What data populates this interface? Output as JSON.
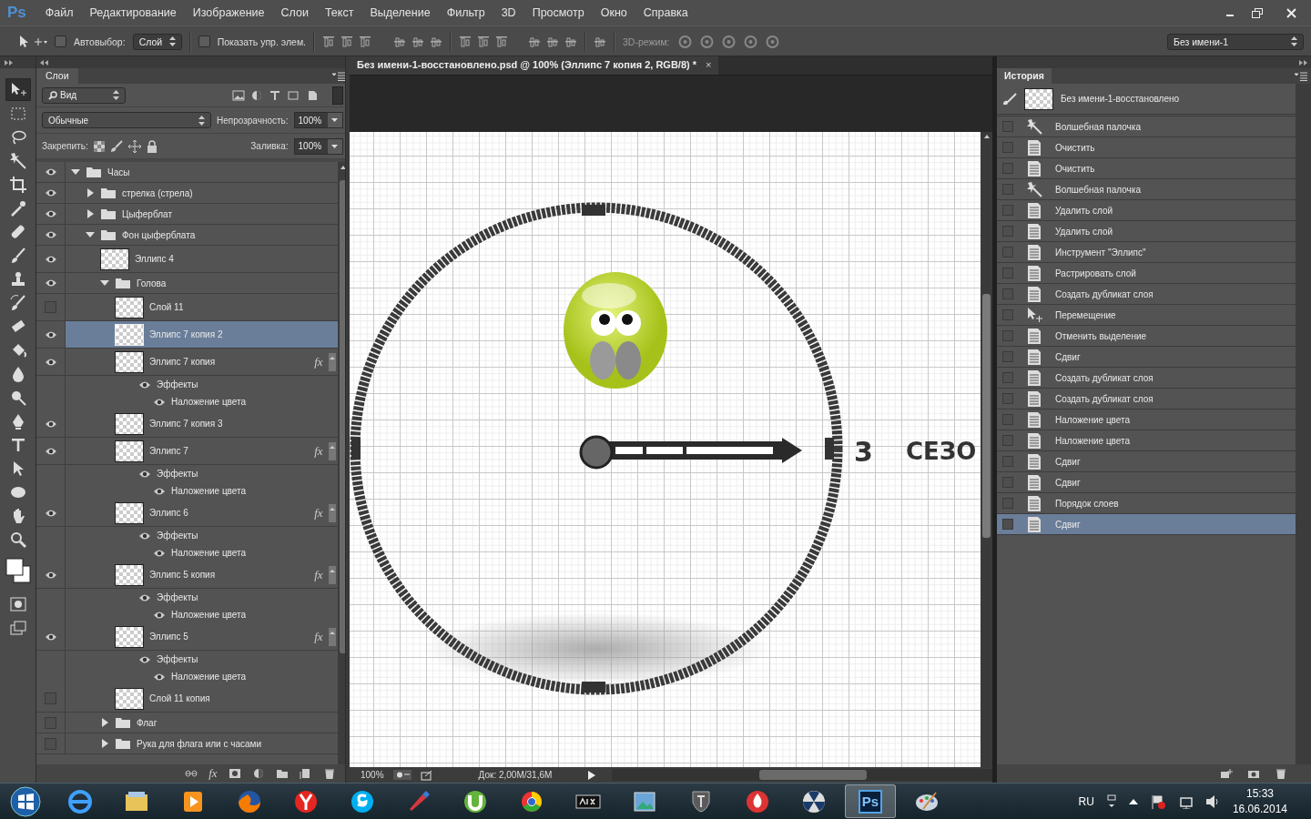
{
  "app": {
    "logo": "Ps",
    "menu": [
      "Файл",
      "Редактирование",
      "Изображение",
      "Слои",
      "Текст",
      "Выделение",
      "Фильтр",
      "3D",
      "Просмотр",
      "Окно",
      "Справка"
    ]
  },
  "options_bar": {
    "auto_select": {
      "label": "Автовыбор:",
      "checked": false
    },
    "target": "Слой",
    "show_controls": {
      "label": "Показать упр. элем.",
      "checked": false
    },
    "mode_3d_label": "3D-режим:",
    "workspace": "Без имени-1"
  },
  "tools": [
    {
      "kind": "move",
      "selected": true
    },
    {
      "kind": "marquee",
      "selected": false
    },
    {
      "kind": "lasso",
      "selected": false
    },
    {
      "kind": "wand",
      "selected": false
    },
    {
      "kind": "crop",
      "selected": false
    },
    {
      "kind": "eyedropper",
      "selected": false
    },
    {
      "kind": "healing",
      "selected": false
    },
    {
      "kind": "brush",
      "selected": false
    },
    {
      "kind": "stamp",
      "selected": false
    },
    {
      "kind": "history-brush",
      "selected": false
    },
    {
      "kind": "eraser",
      "selected": false
    },
    {
      "kind": "bucket",
      "selected": false
    },
    {
      "kind": "blur",
      "selected": false
    },
    {
      "kind": "dodge",
      "selected": false
    },
    {
      "kind": "pen",
      "selected": false
    },
    {
      "kind": "type",
      "selected": false
    },
    {
      "kind": "path-select",
      "selected": false
    },
    {
      "kind": "ellipse",
      "selected": false
    },
    {
      "kind": "hand",
      "selected": false
    },
    {
      "kind": "zoom",
      "selected": false
    }
  ],
  "layers_panel": {
    "tab": "Слои",
    "filter": "Вид",
    "blend_mode": "Обычные",
    "opacity_label": "Непрозрачность:",
    "opacity": "100%",
    "lock_label": "Закрепить:",
    "fill_label": "Заливка:",
    "fill": "100%",
    "footer_fx": "fx",
    "layers": [
      {
        "name": "Часы",
        "kind": "folder",
        "visible": true,
        "expanded": true,
        "selected": false,
        "children": [
          {
            "name": "стрелка (стрела)",
            "kind": "folder",
            "visible": true,
            "expanded": false,
            "selected": false
          },
          {
            "name": "Цыферблат",
            "kind": "folder",
            "visible": true,
            "expanded": false,
            "selected": false
          },
          {
            "name": "Фон цыферблата",
            "kind": "folder",
            "visible": true,
            "expanded": true,
            "selected": false,
            "children": [
              {
                "name": "Эллипс 4",
                "kind": "layer",
                "visible": true,
                "selected": false
              },
              {
                "name": "Голова",
                "kind": "folder",
                "visible": true,
                "expanded": true,
                "selected": false,
                "children": [
                  {
                    "name": "Слой 11",
                    "kind": "layer",
                    "visible": false,
                    "selected": false
                  },
                  {
                    "name": "Эллипс 7 копия 2",
                    "kind": "layer",
                    "visible": true,
                    "selected": true
                  },
                  {
                    "name": "Эллипс 7 копия",
                    "kind": "layer",
                    "visible": true,
                    "selected": false,
                    "fx": "fx",
                    "effects_label": "Эффекты",
                    "effects": [
                      "Наложение цвета"
                    ]
                  },
                  {
                    "name": "Эллипс 7 копия 3",
                    "kind": "layer",
                    "visible": true,
                    "selected": false
                  },
                  {
                    "name": "Эллипс 7",
                    "kind": "layer",
                    "visible": true,
                    "selected": false,
                    "fx": "fx",
                    "effects_label": "Эффекты",
                    "effects": [
                      "Наложение цвета"
                    ]
                  },
                  {
                    "name": "Эллипс 6",
                    "kind": "layer",
                    "visible": true,
                    "selected": false,
                    "fx": "fx",
                    "effects_label": "Эффекты",
                    "effects": [
                      "Наложение цвета"
                    ]
                  },
                  {
                    "name": "Эллипс 5 копия",
                    "kind": "layer",
                    "visible": true,
                    "selected": false,
                    "fx": "fx",
                    "effects_label": "Эффекты",
                    "effects": [
                      "Наложение цвета"
                    ]
                  },
                  {
                    "name": "Эллипс 5",
                    "kind": "layer",
                    "visible": true,
                    "selected": false,
                    "fx": "fx",
                    "effects_label": "Эффекты",
                    "effects": [
                      "Наложение цвета"
                    ]
                  },
                  {
                    "name": "Слой 11 копия",
                    "kind": "layer",
                    "visible": false,
                    "selected": false
                  }
                ]
              },
              {
                "name": "Флаг",
                "kind": "folder",
                "visible": false,
                "expanded": false,
                "selected": false
              },
              {
                "name": "Рука для флага или с часами",
                "kind": "folder",
                "visible": false,
                "expanded": false,
                "selected": false
              }
            ]
          }
        ]
      }
    ]
  },
  "document": {
    "tab_title": "Без имени-1-восстановлено.psd @ 100% (Эллипс 7 копия 2, RGB/8) *",
    "close": "×",
    "canvas": {
      "number": "3",
      "word": "СЕЗО"
    },
    "zoom": "100%",
    "doc_info": "Док: 2,00M/31,6M"
  },
  "history_panel": {
    "tab": "История",
    "snapshot": "Без имени-1-восстановлено",
    "items": [
      {
        "label": "Волшебная палочка",
        "kind": "wand",
        "selected": false
      },
      {
        "label": "Очистить",
        "kind": "doc",
        "selected": false
      },
      {
        "label": "Очистить",
        "kind": "doc",
        "selected": false
      },
      {
        "label": "Волшебная палочка",
        "kind": "wand",
        "selected": false
      },
      {
        "label": "Удалить слой",
        "kind": "doc",
        "selected": false
      },
      {
        "label": "Удалить слой",
        "kind": "doc",
        "selected": false
      },
      {
        "label": "Инструмент \"Эллипс\"",
        "kind": "doc",
        "selected": false
      },
      {
        "label": "Растрировать слой",
        "kind": "doc",
        "selected": false
      },
      {
        "label": "Создать дубликат слоя",
        "kind": "doc",
        "selected": false
      },
      {
        "label": "Перемещение",
        "kind": "move",
        "selected": false
      },
      {
        "label": "Отменить выделение",
        "kind": "doc",
        "selected": false
      },
      {
        "label": "Сдвиг",
        "kind": "doc",
        "selected": false
      },
      {
        "label": "Создать дубликат слоя",
        "kind": "doc",
        "selected": false
      },
      {
        "label": "Создать дубликат слоя",
        "kind": "doc",
        "selected": false
      },
      {
        "label": "Наложение цвета",
        "kind": "doc",
        "selected": false
      },
      {
        "label": "Наложение цвета",
        "kind": "doc",
        "selected": false
      },
      {
        "label": "Сдвиг",
        "kind": "doc",
        "selected": false
      },
      {
        "label": "Сдвиг",
        "kind": "doc",
        "selected": false
      },
      {
        "label": "Порядок слоев",
        "kind": "doc",
        "selected": false
      },
      {
        "label": "Сдвиг",
        "kind": "doc",
        "selected": true
      }
    ]
  },
  "taskbar": {
    "apps": [
      {
        "kind": "globe",
        "selected": false
      },
      {
        "kind": "folder",
        "selected": false
      },
      {
        "kind": "player",
        "selected": false
      },
      {
        "kind": "fox",
        "selected": false
      },
      {
        "kind": "y",
        "selected": false
      },
      {
        "kind": "chat",
        "selected": false
      },
      {
        "kind": "brush",
        "selected": false
      },
      {
        "kind": "torrent",
        "selected": false
      },
      {
        "kind": "browser",
        "selected": false
      },
      {
        "kind": "game",
        "selected": false
      },
      {
        "kind": "picture",
        "selected": false
      },
      {
        "kind": "tank",
        "selected": false
      },
      {
        "kind": "flame",
        "selected": false
      },
      {
        "kind": "hazard",
        "selected": false
      },
      {
        "kind": "photoshop",
        "label": "Ps",
        "selected": true
      },
      {
        "kind": "palette",
        "selected": false
      }
    ],
    "language": "RU",
    "time": "15:33",
    "date": "16.06.2014"
  }
}
